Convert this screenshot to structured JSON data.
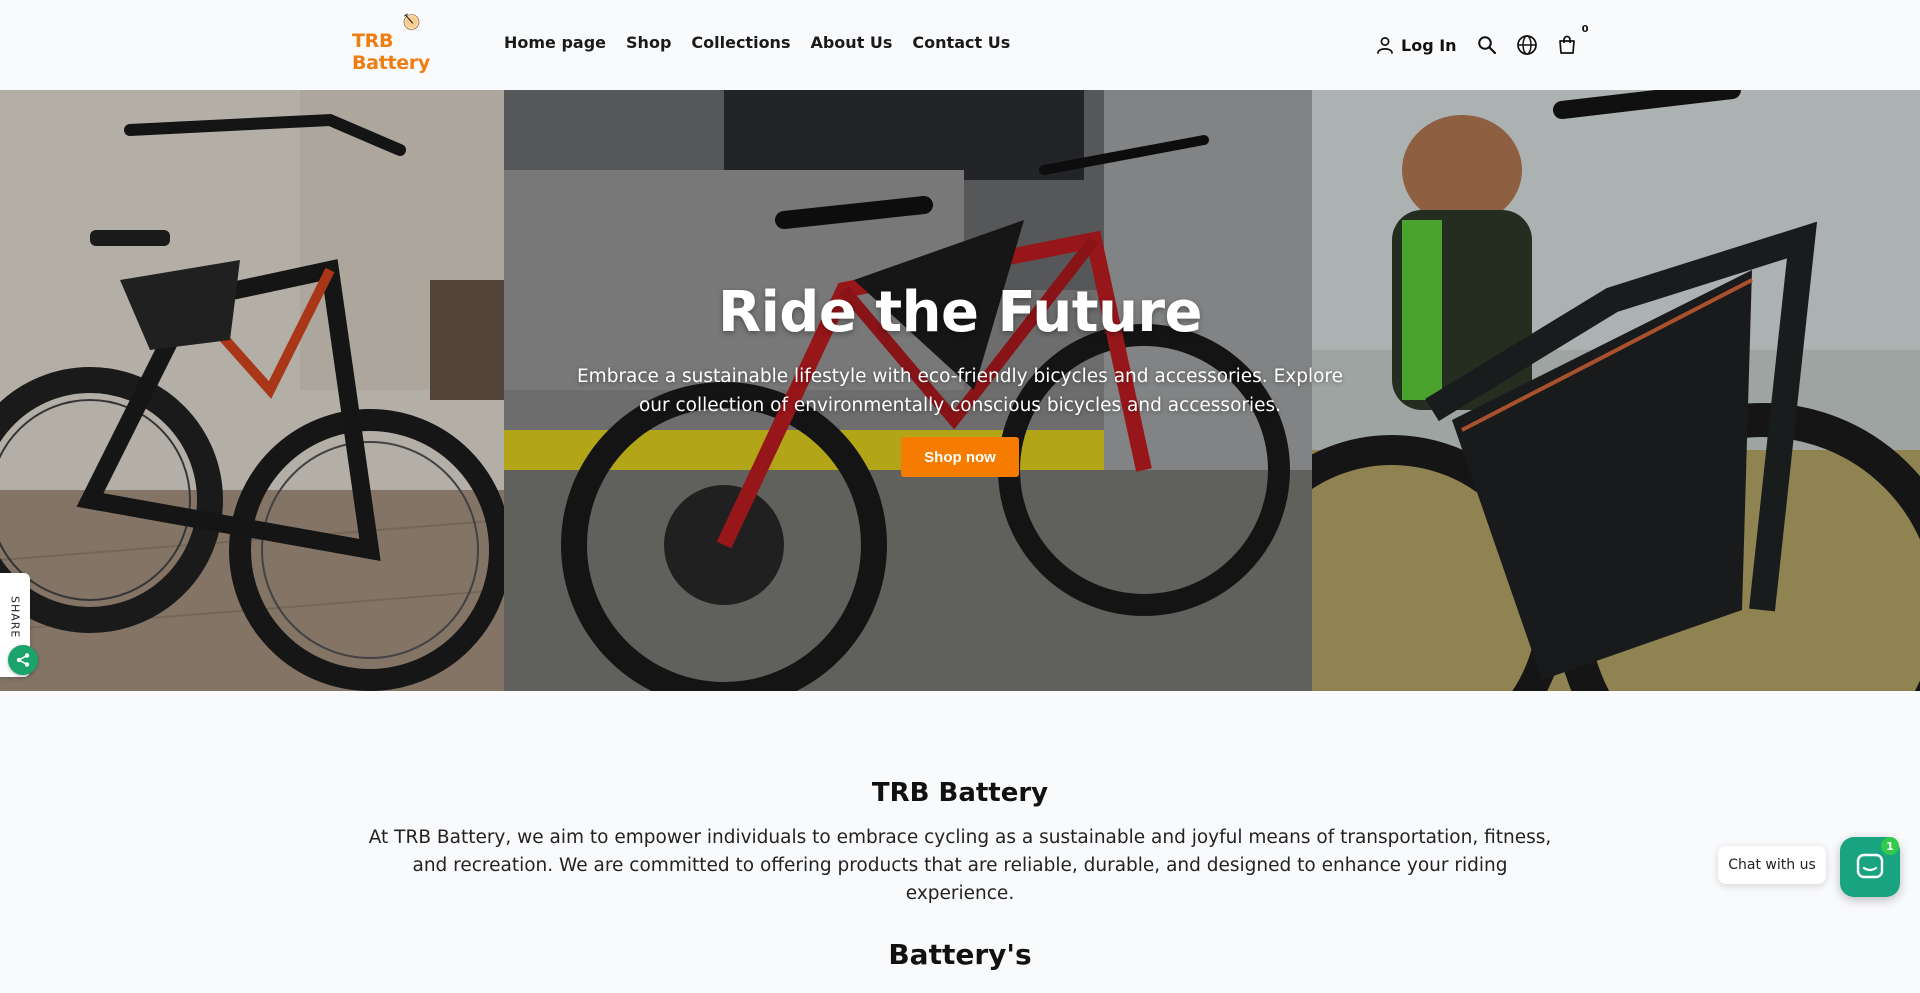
{
  "brand": {
    "name": "TRB Battery",
    "color": "#ef7d12"
  },
  "nav": {
    "items": [
      "Home page",
      "Shop",
      "Collections",
      "About Us",
      "Contact Us"
    ]
  },
  "header": {
    "login_label": "Log In",
    "cart_count": "0",
    "icons": [
      "user-icon",
      "search-icon",
      "globe-icon",
      "cart-icon"
    ]
  },
  "hero": {
    "title": "Ride the Future",
    "text": "Embrace a sustainable lifestyle with eco-friendly bicycles and accessories. Explore our collection of environmentally conscious bicycles and accessories.",
    "button_label": "Shop now",
    "button_color": "#f57c00"
  },
  "share": {
    "label": "SHARE",
    "color": "#1aa36b"
  },
  "about": {
    "title": "TRB Battery",
    "text": "At TRB Battery, we aim to empower individuals to embrace cycling as a sustainable and joyful means of transportation, fitness, and recreation. We are committed to offering products that are reliable, durable, and designed to enhance your riding experience."
  },
  "section": {
    "title": "Battery's"
  },
  "chat": {
    "label": "Chat with us",
    "badge": "1",
    "color": "#18a480"
  }
}
